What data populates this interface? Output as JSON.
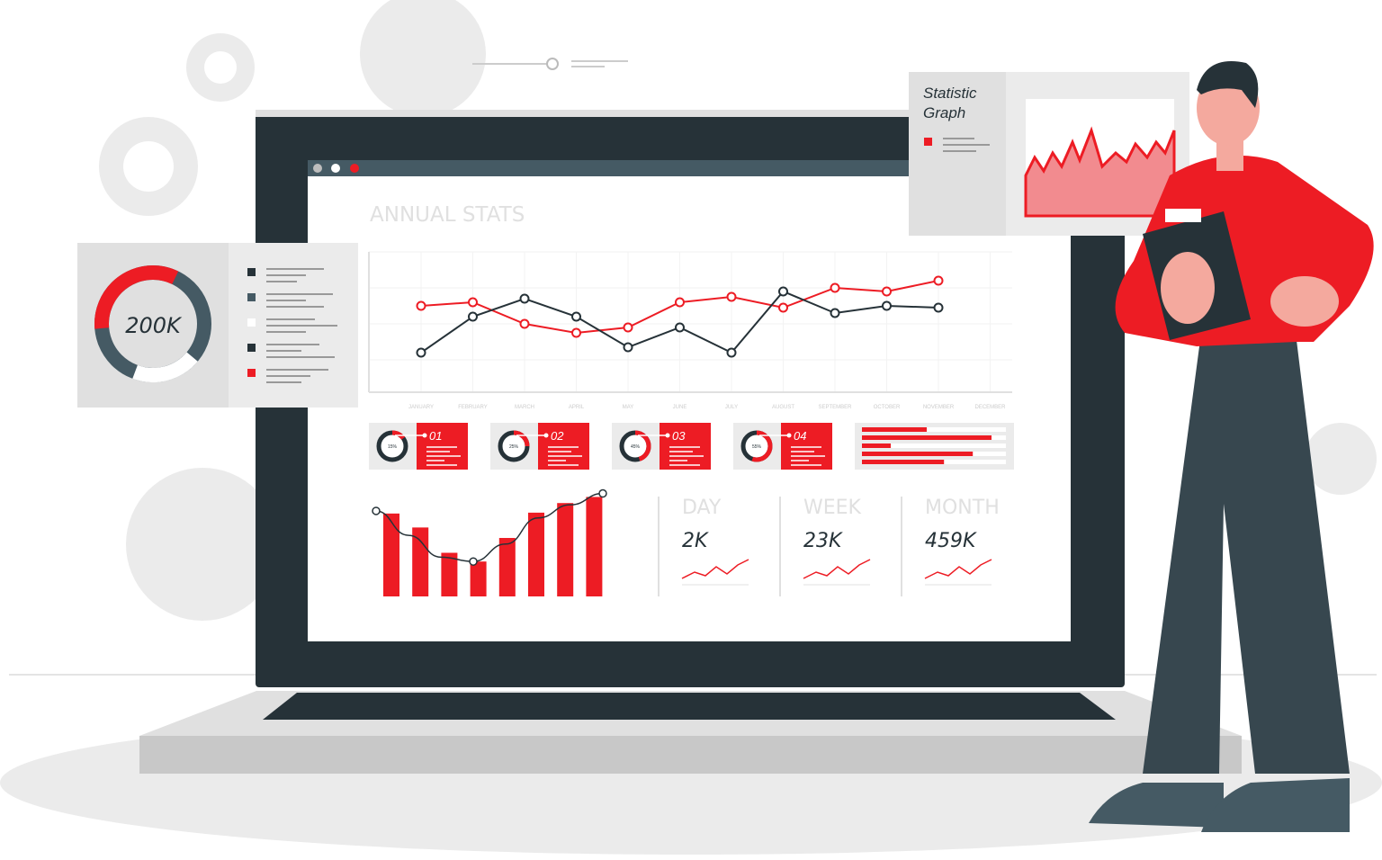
{
  "colors": {
    "accent": "#ed1c24",
    "dark": "#263238",
    "screen_bar": "#455a64",
    "light_gray": "#ebebeb",
    "mid_gray": "#e0e0e0",
    "line_light": "#f5a3a6"
  },
  "screen": {
    "title": "ANNUAL STATS",
    "window_dots": [
      "gray",
      "white",
      "red"
    ]
  },
  "side_panel": {
    "donut_value": "200K"
  },
  "statistic_card": {
    "title_line1": "Statistic",
    "title_line2": "Graph"
  },
  "kpi_cards": [
    {
      "number": "01",
      "percent": "15%",
      "fraction": 0.15
    },
    {
      "number": "02",
      "percent": "25%",
      "fraction": 0.25
    },
    {
      "number": "03",
      "percent": "45%",
      "fraction": 0.45
    },
    {
      "number": "04",
      "percent": "55%",
      "fraction": 0.55
    }
  ],
  "horizontal_bars": [
    0.45,
    0.9,
    0.2,
    0.77,
    0.57
  ],
  "period_stats": [
    {
      "label": "DAY",
      "value": "2K"
    },
    {
      "label": "WEEK",
      "value": "23K"
    },
    {
      "label": "MONTH",
      "value": "459K"
    }
  ],
  "chart_data": [
    {
      "type": "line",
      "categories": [
        "JANUARY",
        "FEBRUARY",
        "MARCH",
        "APRIL",
        "MAY",
        "JUNE",
        "JULY",
        "AUGUST",
        "SEPTEMBER",
        "OCTOBER",
        "NOVEMBER",
        "DECEMBER"
      ],
      "ylim": [
        0,
        4
      ],
      "grid": true,
      "series": [
        {
          "color": "#ed1c24",
          "values": [
            1.5,
            1.6,
            1.0,
            0.75,
            0.9,
            1.6,
            1.75,
            1.45,
            2.0,
            1.9,
            2.2
          ]
        },
        {
          "color": "#263238",
          "values": [
            0.2,
            1.2,
            1.7,
            1.2,
            0.35,
            0.9,
            0.2,
            1.9,
            1.3,
            1.5,
            1.45
          ]
        }
      ]
    },
    {
      "type": "bar",
      "ylim": [
        0,
        120
      ],
      "values": [
        95,
        79,
        50,
        40,
        67,
        96,
        107,
        114
      ],
      "trend": [
        98,
        70,
        45,
        40,
        60,
        90,
        105,
        118
      ]
    }
  ]
}
